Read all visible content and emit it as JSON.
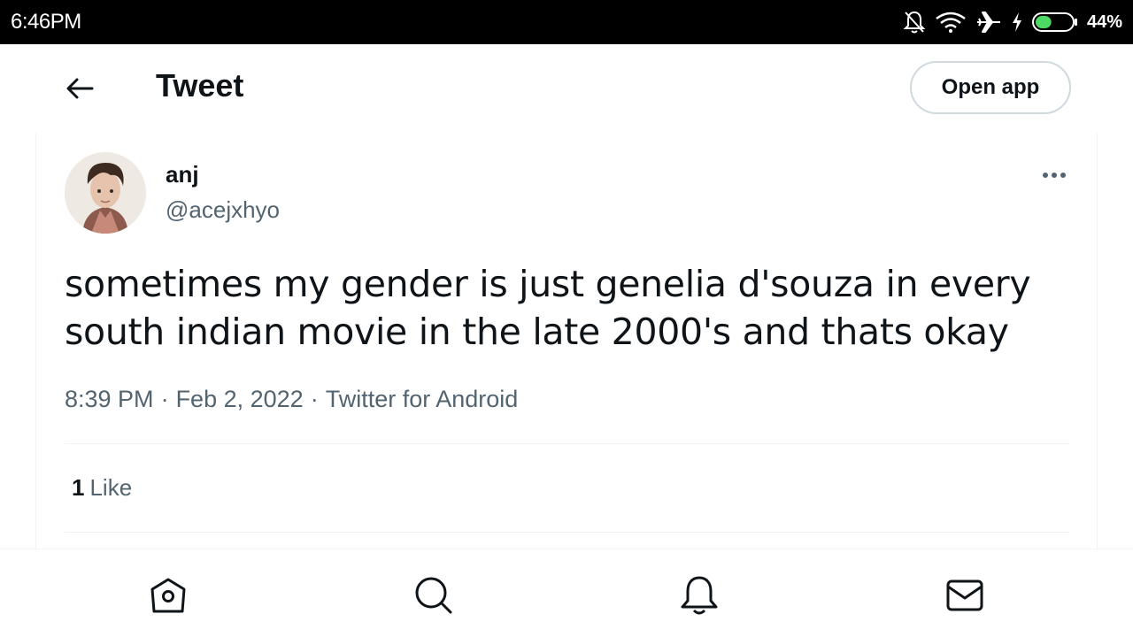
{
  "status_bar": {
    "time": "6:46PM",
    "battery_percent": "44%",
    "battery_level": 0.44,
    "icons": [
      "bell-off-icon",
      "wifi-icon",
      "airplane-icon",
      "charging-icon",
      "battery-icon"
    ]
  },
  "header": {
    "title": "Tweet",
    "open_app_label": "Open app"
  },
  "tweet": {
    "author_name": "anj",
    "author_handle": "@acejxhyo",
    "text": "sometimes my gender is just genelia d'souza in every south indian movie in the late 2000's and thats okay",
    "time": "8:39 PM",
    "date": "Feb 2, 2022",
    "source": "Twitter for Android",
    "separator": "·",
    "likes_count": "1",
    "likes_label": "Like"
  },
  "bottom_nav": {
    "items": [
      "home-icon",
      "search-icon",
      "notifications-icon",
      "messages-icon"
    ]
  },
  "colors": {
    "text_primary": "#0f1419",
    "text_secondary": "#536471",
    "border": "#cfd9de",
    "divider": "#eff3f4",
    "battery_fill": "#4cd964"
  }
}
